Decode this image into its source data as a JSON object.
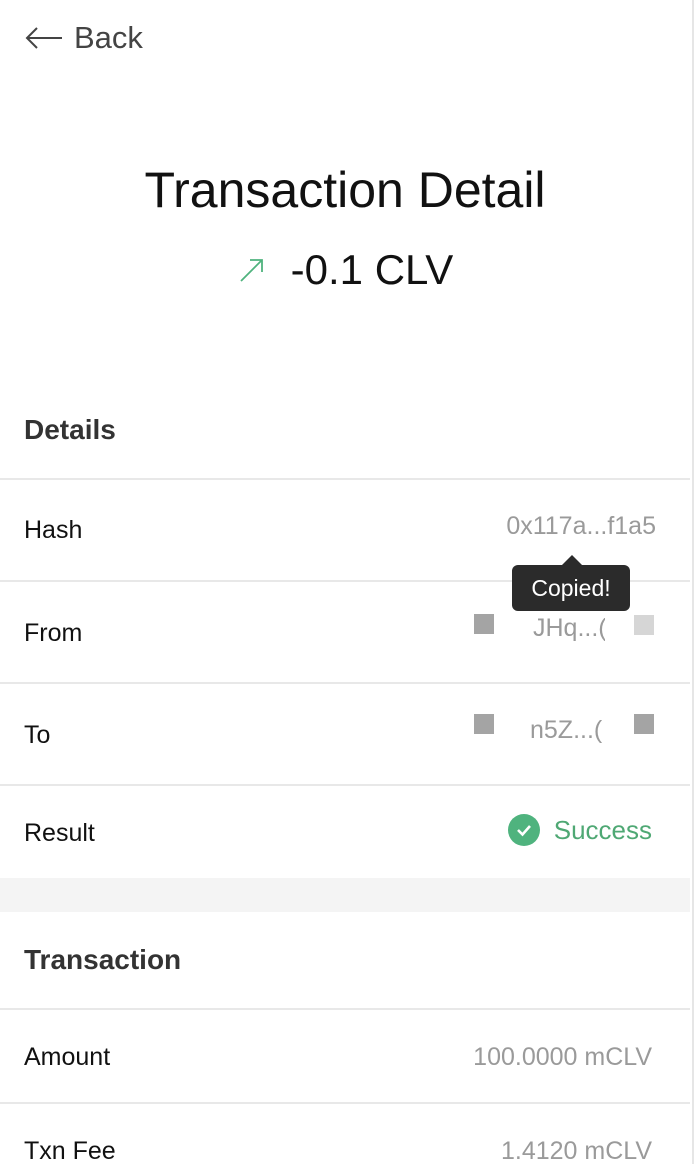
{
  "header": {
    "back_label": "Back"
  },
  "title": "Transaction Detail",
  "amount": "-0.1 CLV",
  "colors": {
    "accent_green": "#4fb37e",
    "tooltip_bg": "#2b2b2b"
  },
  "details": {
    "section_title": "Details",
    "hash_label": "Hash",
    "hash_value": "0x117a...f1a5",
    "from_label": "From",
    "from_value": "JHq...(",
    "to_label": "To",
    "to_value": "n5Z...(",
    "result_label": "Result",
    "result_value": "Success",
    "tooltip": "Copied!"
  },
  "transaction": {
    "section_title": "Transaction",
    "amount_label": "Amount",
    "amount_value": "100.0000 mCLV",
    "fee_label": "Txn Fee",
    "fee_value": "1.4120 mCLV"
  }
}
